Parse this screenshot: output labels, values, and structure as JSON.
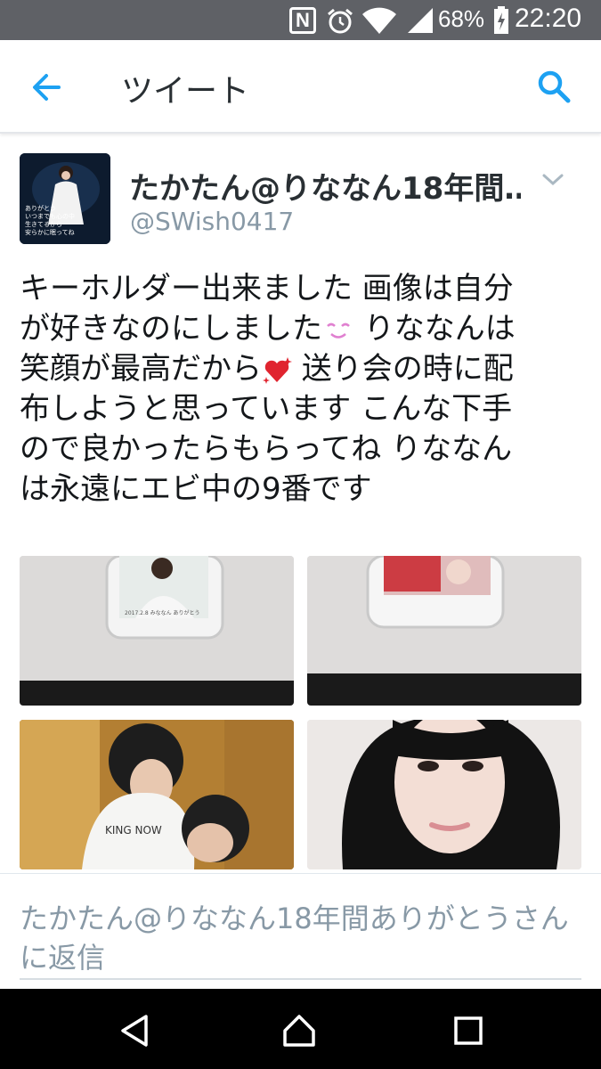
{
  "status_bar": {
    "nfc_label": "N",
    "battery_percent": "68%",
    "time": "22:20",
    "icons": [
      "nfc-icon",
      "alarm-icon",
      "wifi-icon",
      "signal-icon",
      "battery-icon"
    ]
  },
  "header": {
    "title": "ツイート",
    "back_icon": "arrow-left-icon",
    "search_icon": "search-icon",
    "accent_color": "#1da1f2"
  },
  "tweet": {
    "display_name": "たかたん@りななん18年間…",
    "handle": "@SWish0417",
    "avatar_caption": "ありがとう\nいつまでも心の中\n生きてるから\n安らかに眠ってね",
    "text_lines": [
      "キーホルダー出来ました 画像は自分",
      "が好きなのにしました",
      " りななんは",
      "笑顔が最高だから",
      " 送り会の時に配",
      "布しようと思っています こんな下手",
      "ので良かったらもらってね りななん",
      "は永遠にエビ中の9番です"
    ],
    "emojis": [
      "smiling-face-emoji",
      "sparkling-heart-emoji"
    ],
    "media": [
      "keychain-photo-1",
      "keychain-photo-2",
      "photo-3",
      "photo-4"
    ],
    "keychain_caption": "2017.2.8 みななん ありがとう"
  },
  "reply": {
    "prompt": "たかたん@りななん18年間ありがとうさんに返信"
  },
  "nav_bar": {
    "icons": [
      "back-triangle-icon",
      "home-icon",
      "recents-icon"
    ]
  },
  "colors": {
    "status_bar_bg": "#5f6166",
    "accent": "#1da1f2",
    "text_primary": "#14171a",
    "text_secondary": "#8899a6"
  }
}
